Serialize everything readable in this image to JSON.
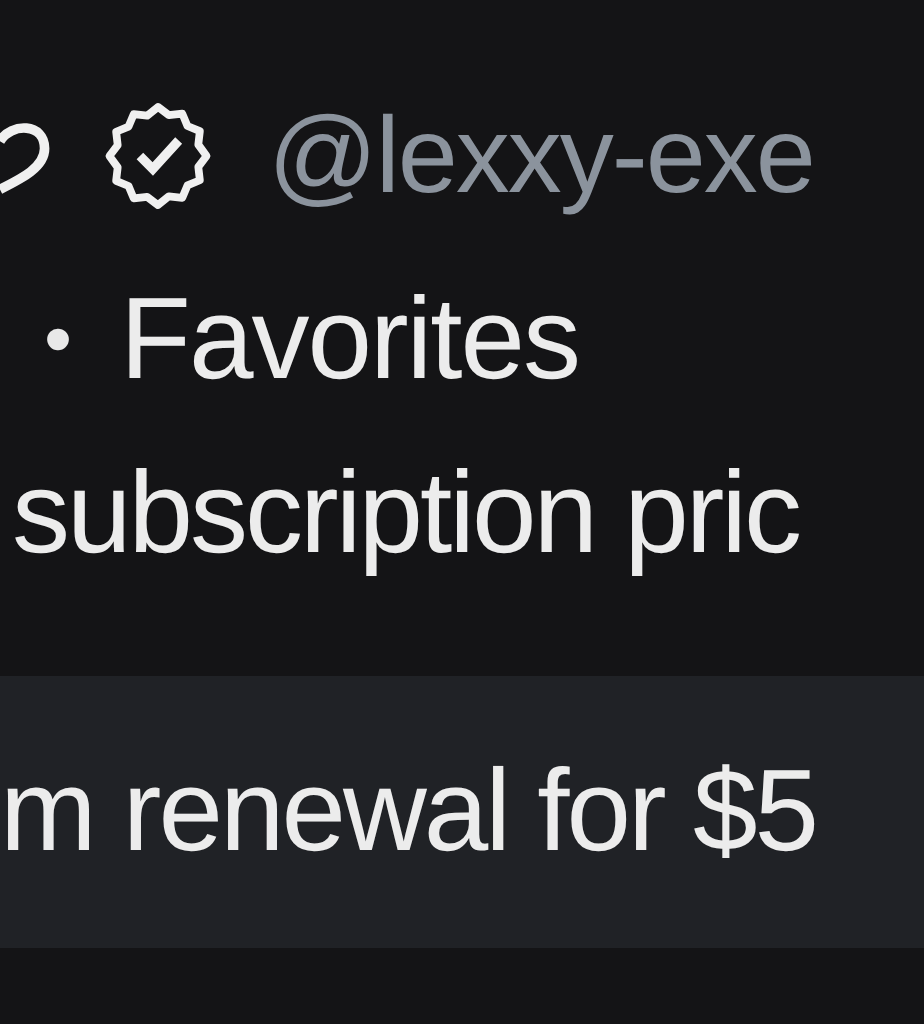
{
  "profile": {
    "handle": "@lexxy-exe",
    "verified": true
  },
  "list": {
    "bullet": "•",
    "label": "Favorites"
  },
  "description": "subscription pric",
  "renewal_banner": {
    "text": "m renewal for $5"
  }
}
